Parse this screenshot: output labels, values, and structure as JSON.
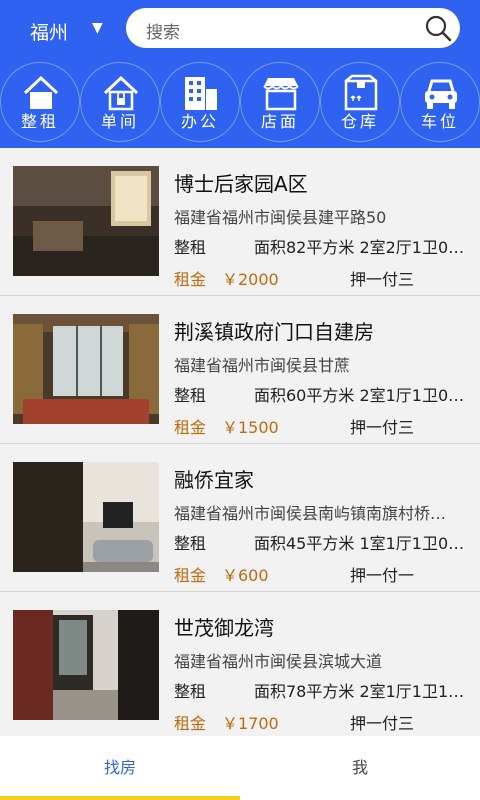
{
  "header": {
    "city": "福州",
    "city_arrow": "▼",
    "search_placeholder": "搜索"
  },
  "categories": [
    {
      "label": "整租",
      "icon": "house-icon"
    },
    {
      "label": "单间",
      "icon": "home-lock-icon"
    },
    {
      "label": "办公",
      "icon": "building-icon"
    },
    {
      "label": "店面",
      "icon": "storefront-icon"
    },
    {
      "label": "仓库",
      "icon": "box-icon"
    },
    {
      "label": "车位",
      "icon": "car-icon"
    }
  ],
  "listings": [
    {
      "title": "博士后家园A区",
      "address": "福建省福州市闽侯县建平路50",
      "type": "整租",
      "area": "面积82平方米 2室2厅1卫0…",
      "rent_label": "租金",
      "price": "￥2000",
      "deposit": "押一付三"
    },
    {
      "title": "荆溪镇政府门口自建房",
      "address": "福建省福州市闽侯县甘蔗",
      "type": "整租",
      "area": "面积60平方米 2室1厅1卫0…",
      "rent_label": "租金",
      "price": "￥1500",
      "deposit": "押一付三"
    },
    {
      "title": "融侨宜家",
      "address": "福建省福州市闽侯县南屿镇南旗村桥…",
      "type": "整租",
      "area": "面积45平方米 1室1厅1卫0…",
      "rent_label": "租金",
      "price": "￥600",
      "deposit": "押一付一"
    },
    {
      "title": "世茂御龙湾",
      "address": "福建省福州市闽侯县滨城大道",
      "type": "整租",
      "area": "面积78平方米 2室1厅1卫1…",
      "rent_label": "租金",
      "price": "￥1700",
      "deposit": "押一付三"
    }
  ],
  "tabs": {
    "find": "找房",
    "me": "我"
  }
}
